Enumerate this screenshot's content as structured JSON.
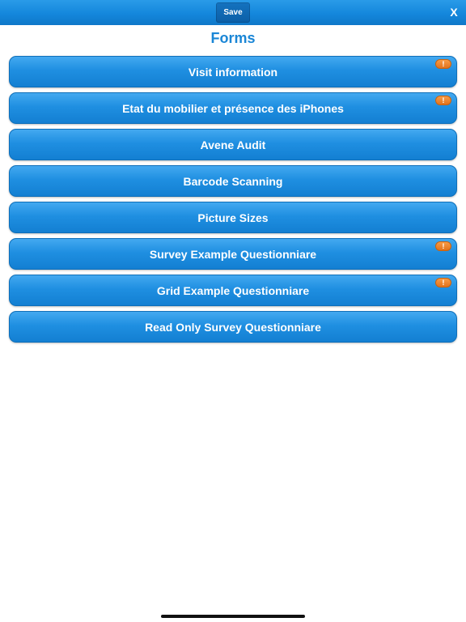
{
  "toolbar": {
    "save_label": "Save",
    "close_label": "X"
  },
  "page": {
    "title": "Forms"
  },
  "forms": [
    {
      "label": "Visit information",
      "alert": true
    },
    {
      "label": "Etat du mobilier et présence des iPhones",
      "alert": true
    },
    {
      "label": "Avene Audit",
      "alert": false
    },
    {
      "label": "Barcode Scanning",
      "alert": false
    },
    {
      "label": "Picture Sizes",
      "alert": false
    },
    {
      "label": "Survey Example Questionniare",
      "alert": true
    },
    {
      "label": "Grid Example Questionniare",
      "alert": true
    },
    {
      "label": "Read Only Survey Questionniare",
      "alert": false
    }
  ],
  "alert_badge": {
    "icon": "exclamation-icon",
    "glyph": "!"
  },
  "colors": {
    "accent": "#1a86d6",
    "button_blue": "#1f8fe1",
    "alert_orange": "#ec8230"
  }
}
